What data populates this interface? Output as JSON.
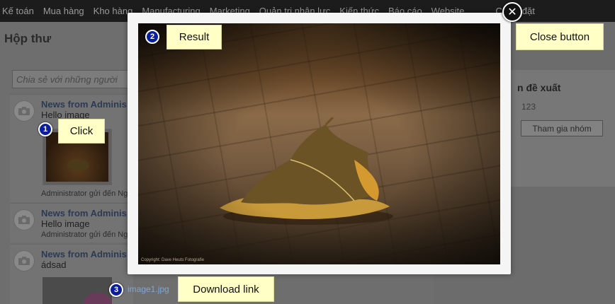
{
  "nav": {
    "items": [
      "Kế toán",
      "Mua hàng",
      "Kho hàng",
      "Manufacturing",
      "Marketing",
      "Quản trị nhân lực",
      "Kiến thức",
      "Báo cáo",
      "Website",
      "C",
      "đặt"
    ]
  },
  "inbox": {
    "title": "Hộp thư",
    "share_placeholder": "Chia sẻ với những người",
    "posts": [
      {
        "author": "News from Adminis",
        "message": "Hello image",
        "meta": "Administrator gửi đến Ngư"
      },
      {
        "author": "News from Adminis",
        "message": "Hello image",
        "meta": "Administrator gửi đến Ng"
      },
      {
        "author": "News from Adminis",
        "message": "ádsad"
      }
    ]
  },
  "groups": {
    "title": "n đề xuất",
    "count": "123",
    "join_label": "Tham gia nhóm"
  },
  "modal": {
    "photo_caption": "Copyright: Dave Heuts Fotografie",
    "close_symbol": "✕"
  },
  "attachment": {
    "filename": "image1.jpg"
  },
  "annotations": [
    {
      "number": "1",
      "label": "Click"
    },
    {
      "number": "2",
      "label": "Result"
    },
    {
      "number": "3",
      "label": "Download link"
    },
    {
      "label": "Close button"
    }
  ],
  "colors": {
    "annotation_number_bg": "#0b1f9e",
    "callout_bg": "#ffffc6",
    "link": "#7ea6d8"
  }
}
